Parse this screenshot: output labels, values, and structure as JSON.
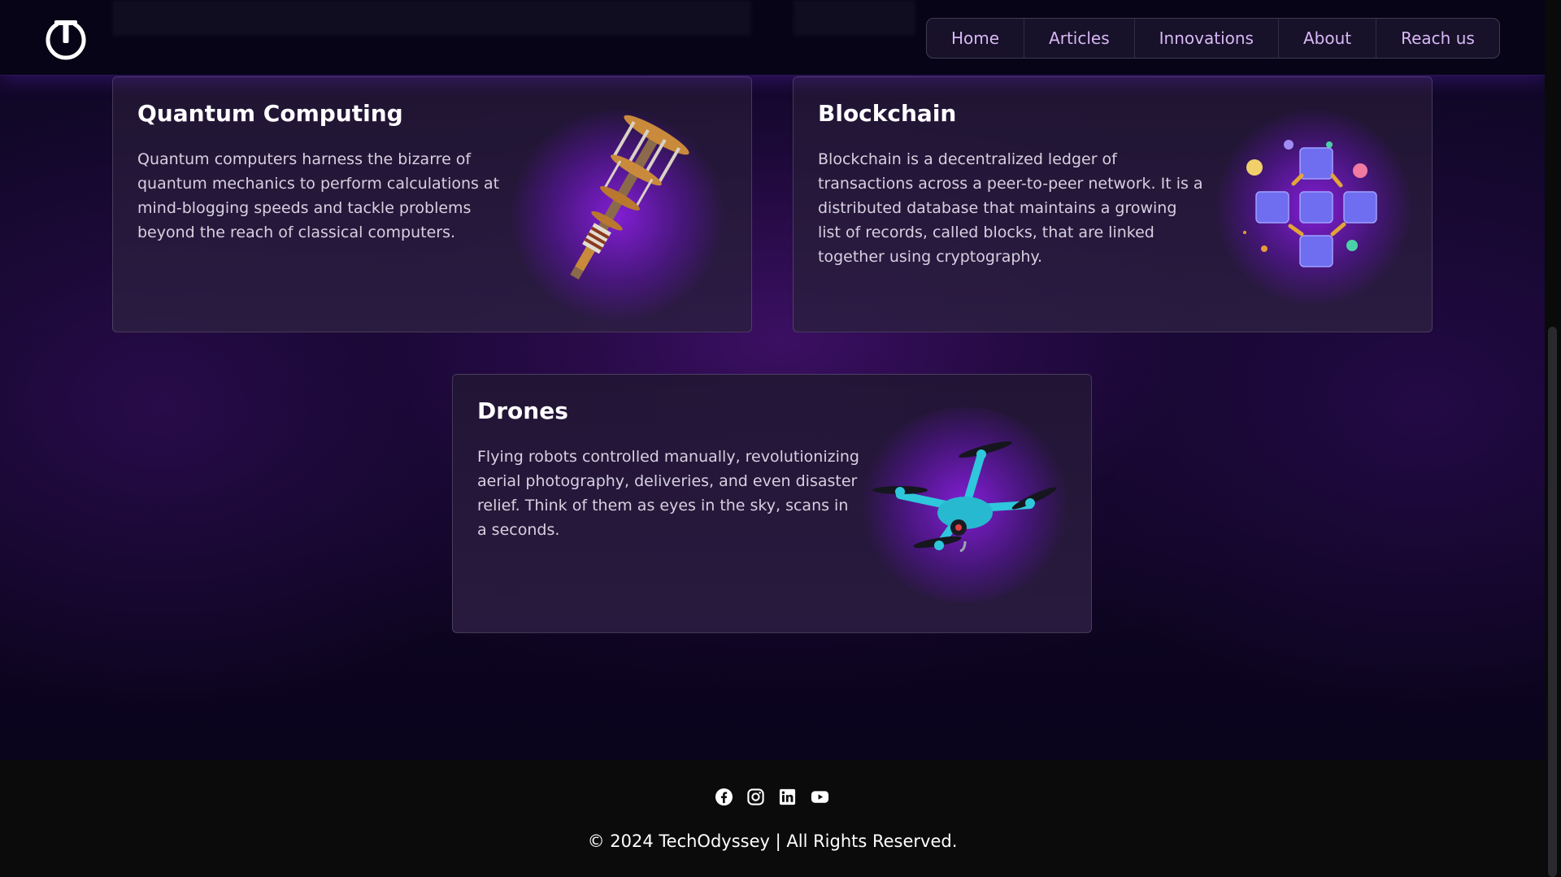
{
  "header": {
    "logo_icon": "power-logo-icon",
    "nav": [
      {
        "label": "Home"
      },
      {
        "label": "Articles"
      },
      {
        "label": "Innovations"
      },
      {
        "label": "About"
      },
      {
        "label": "Reach us"
      }
    ]
  },
  "cards": [
    {
      "title": "Quantum Computing",
      "text": "Quantum computers harness the bizarre of quantum mechanics to perform calculations at mind-blogging speeds and tackle problems beyond the reach of classical computers.",
      "image_icon": "quantum-computer-illustration"
    },
    {
      "title": "Blockchain",
      "text": "Blockchain is a decentralized ledger of transactions across a peer-to-peer network. It is a distributed database that maintains a growing list of records, called blocks, that are linked together using cryptography.",
      "image_icon": "blockchain-cubes-illustration"
    },
    {
      "title": "Drones",
      "text": "Flying robots controlled manually, revolutionizing aerial photography, deliveries, and even disaster relief. Think of them as eyes in the sky, scans in a seconds.",
      "image_icon": "drone-illustration"
    }
  ],
  "footer": {
    "social": [
      "facebook-icon",
      "instagram-icon",
      "linkedin-icon",
      "youtube-icon"
    ],
    "copyright": "© 2024 TechOdyssey | All Rights Reserved."
  },
  "colors": {
    "nav_text": "#d9b8f5",
    "accent_glow": "#8c1ee6",
    "footer_bg": "#0b0b0b"
  }
}
